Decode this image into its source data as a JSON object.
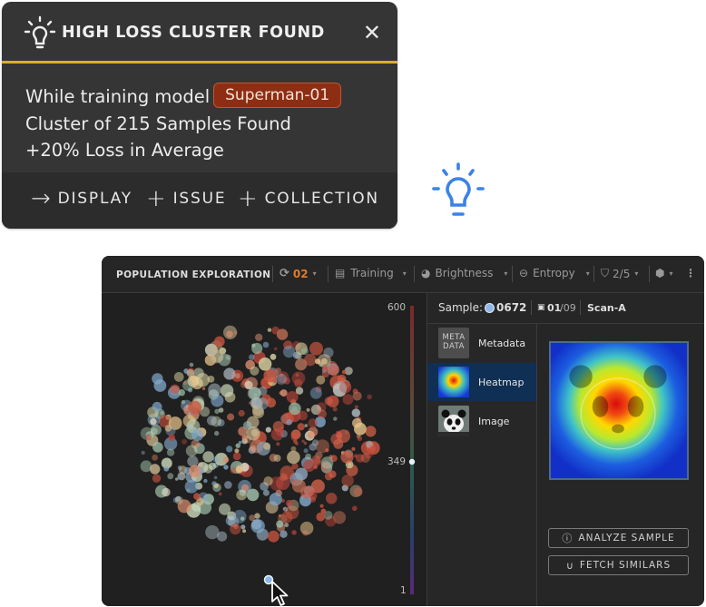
{
  "alert": {
    "title": "HIGH LOSS CLUSTER FOUND",
    "close": "✕",
    "line1": "While training model",
    "model": "Superman-01",
    "line2": "Cluster of 215 Samples Found",
    "line3": "+20% Loss in Average",
    "actions": [
      {
        "glyph": "→",
        "label": "DISPLAY"
      },
      {
        "glyph": "+",
        "label": "ISSUE"
      },
      {
        "glyph": "+",
        "label": "COLLECTION"
      }
    ],
    "accent": "#d9ae2a"
  },
  "panel": {
    "title": "POPULATION EXPLORATION",
    "toolbar": {
      "version": "02",
      "dataset": "Training",
      "color_by": "Brightness",
      "size_by": "Entropy",
      "filter": "2/5"
    },
    "colorbar": {
      "max": "600",
      "mid": "349",
      "min": "1"
    },
    "sample": {
      "label": "Sample:",
      "id": "0672",
      "index": "01",
      "total": "/09",
      "scan": "Scan-A"
    },
    "list": [
      {
        "thumb": "META DATA",
        "label": "Metadata"
      },
      {
        "thumb": "heatmap",
        "label": "Heatmap"
      },
      {
        "thumb": "image",
        "label": "Image"
      }
    ],
    "buttons": {
      "analyze": "ANALYZE SAMPLE",
      "fetch": "FETCH SIMILARS"
    }
  },
  "icons": [
    "lightbulb-icon",
    "close-icon",
    "arrow-right-icon",
    "plus-icon",
    "refresh-icon",
    "calendar-icon",
    "palette-icon",
    "entropy-icon",
    "filter-icon",
    "cube-icon",
    "more-icon",
    "image-icon",
    "info-icon",
    "magnet-icon",
    "cursor-icon"
  ]
}
